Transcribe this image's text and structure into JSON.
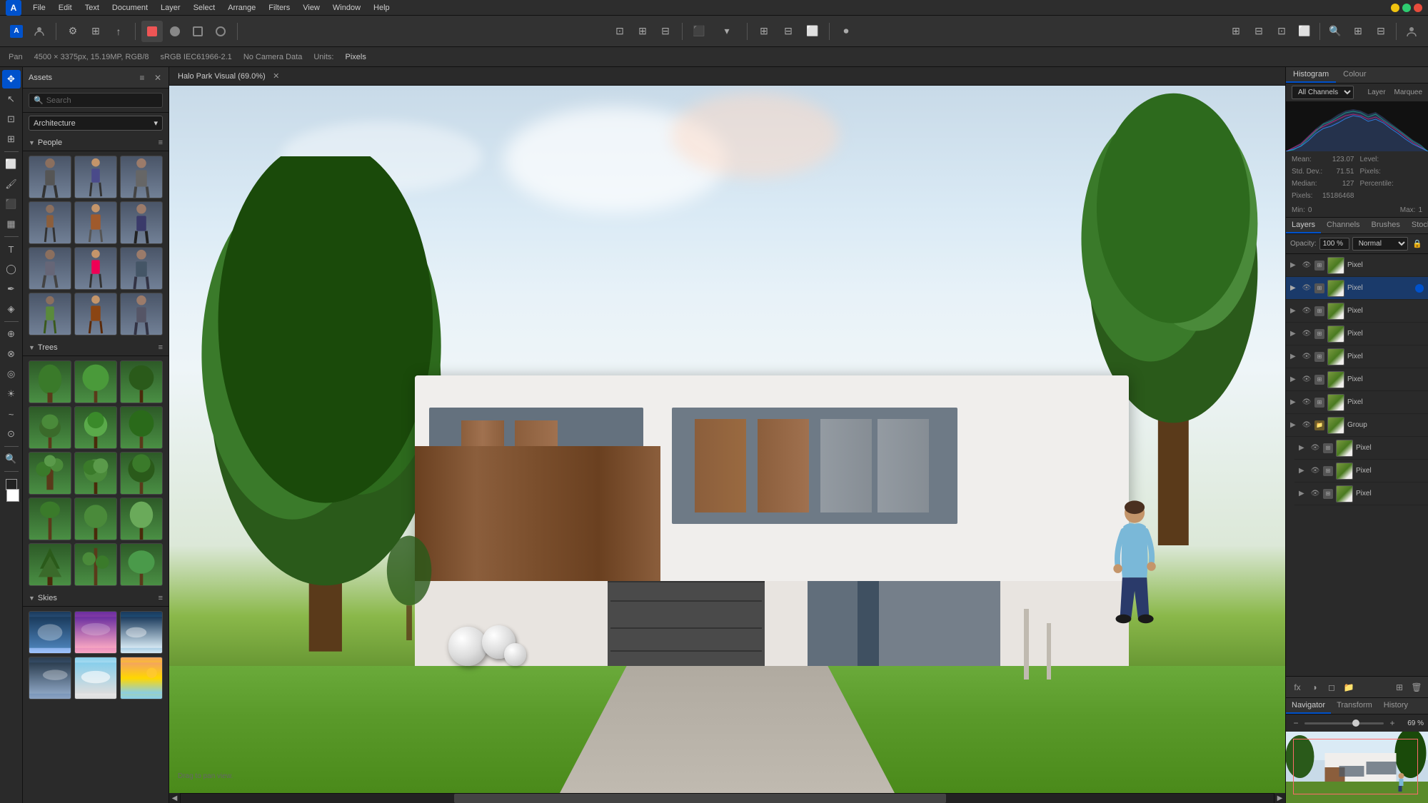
{
  "app": {
    "name": "Affinity Photo",
    "logo": "A"
  },
  "menu": {
    "items": [
      "File",
      "Edit",
      "Text",
      "Document",
      "Layer",
      "Select",
      "Arrange",
      "Filters",
      "View",
      "Window",
      "Help"
    ]
  },
  "statusbar": {
    "tool": "Pan",
    "dimensions": "4500 × 3375px, 15.19MP, RGB/8",
    "profile": "sRGB IEC61966-2.1",
    "camera": "No Camera Data",
    "units_label": "Units:",
    "units": "Pixels"
  },
  "assets_panel": {
    "title": "Assets",
    "search_placeholder": "Search",
    "category": "Architecture",
    "sections": {
      "people": "People",
      "trees": "Trees",
      "skies": "Skies"
    }
  },
  "canvas": {
    "tab_label": "Halo Park Visual (69.0%)",
    "drag_hint": "Drag to pan view."
  },
  "histogram": {
    "tabs": [
      "Histogram",
      "Colour"
    ],
    "active_tab": "Histogram",
    "channel": "All Channels",
    "layer_tab": "Layer",
    "marquee_tab": "Marquee",
    "stats": {
      "mean_label": "Mean:",
      "mean_value": "123.07",
      "level_label": "Level:",
      "level_value": "",
      "stddev_label": "Std. Dev.:",
      "stddev_value": "71.51",
      "pixels_col_label": "Pixels:",
      "pixels_col_value": "",
      "median_label": "Median:",
      "median_value": "127",
      "percentile_label": "Percentile:",
      "percentile_value": "",
      "pixels_label": "Pixels:",
      "pixels_value": "15186468",
      "min_label": "Min:",
      "min_value": "0",
      "max_label": "Max:",
      "max_value": "1"
    }
  },
  "layers": {
    "tabs": [
      "Layers",
      "Channels",
      "Brushes",
      "Stock"
    ],
    "active_tab": "Layers",
    "opacity_label": "Opacity:",
    "opacity_value": "100 %",
    "blend_mode": "Normal",
    "items": [
      {
        "name": "Pixel",
        "type": "pixel",
        "active": false,
        "has_dot": false,
        "indent": 0
      },
      {
        "name": "Pixel",
        "type": "pixel",
        "active": true,
        "has_dot": true,
        "indent": 0
      },
      {
        "name": "Pixel",
        "type": "pixel",
        "active": false,
        "has_dot": false,
        "indent": 0
      },
      {
        "name": "Pixel",
        "type": "pixel",
        "active": false,
        "has_dot": false,
        "indent": 0
      },
      {
        "name": "Pixel",
        "type": "pixel",
        "active": false,
        "has_dot": false,
        "indent": 0
      },
      {
        "name": "Pixel",
        "type": "pixel",
        "active": false,
        "has_dot": false,
        "indent": 0
      },
      {
        "name": "Pixel",
        "type": "pixel",
        "active": false,
        "has_dot": false,
        "indent": 0
      },
      {
        "name": "Group",
        "type": "group",
        "active": false,
        "has_dot": false,
        "indent": 0
      },
      {
        "name": "Pixel",
        "type": "pixel",
        "active": false,
        "has_dot": false,
        "indent": 1
      },
      {
        "name": "Pixel",
        "type": "pixel",
        "active": false,
        "has_dot": false,
        "indent": 1
      },
      {
        "name": "Pixel",
        "type": "pixel",
        "active": false,
        "has_dot": false,
        "indent": 1
      }
    ]
  },
  "navigator": {
    "tabs": [
      "Navigator",
      "Transform",
      "History"
    ],
    "active_tab": "Navigator",
    "zoom_value": "69 %"
  }
}
